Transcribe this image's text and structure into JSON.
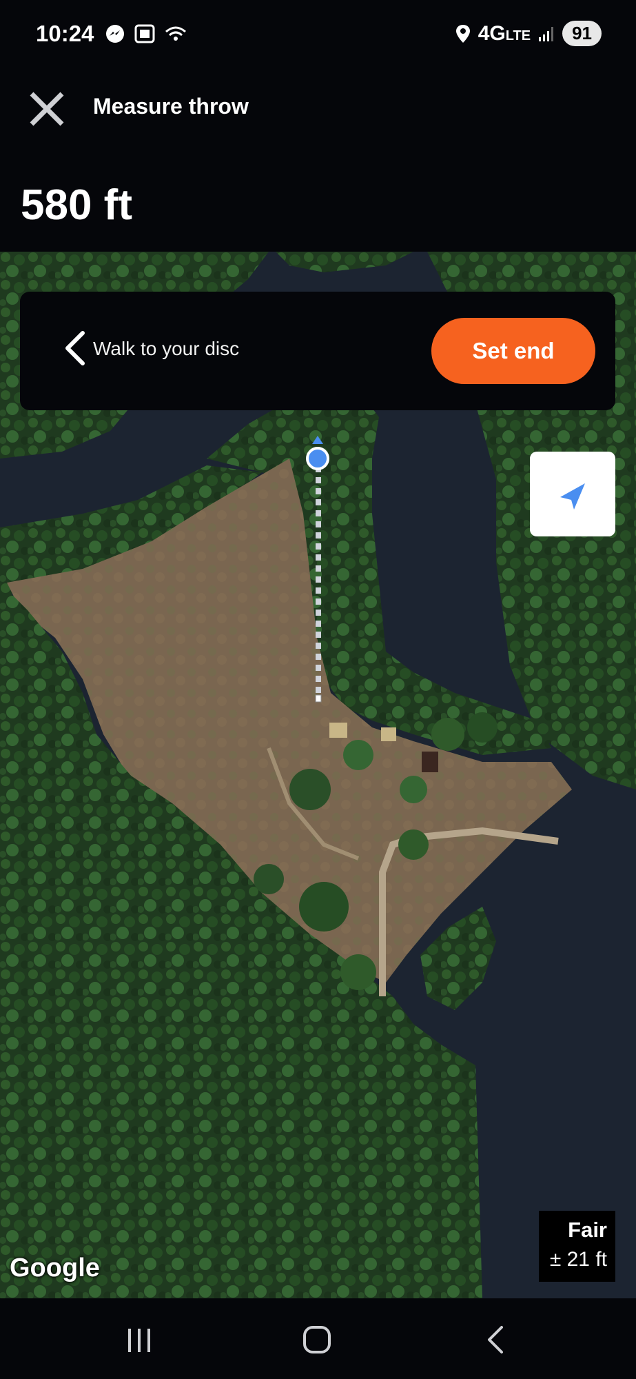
{
  "status_bar": {
    "time": "10:24",
    "network": "4G",
    "network_suffix": "LTE",
    "battery": "91"
  },
  "header": {
    "title": "Measure throw",
    "distance": "580 ft"
  },
  "walk_card": {
    "instruction": "Walk to your disc",
    "action_label": "Set end"
  },
  "accuracy": {
    "label": "Fair",
    "value": "± 21 ft"
  },
  "map": {
    "attribution": "Google",
    "view": "satellite"
  },
  "colors": {
    "accent": "#f6621f",
    "location_dot": "#4a8ef0",
    "background": "#05060a"
  },
  "icons": [
    "close-icon",
    "back-chevron-icon",
    "navigation-arrow-icon",
    "recents-icon",
    "home-icon",
    "back-icon"
  ]
}
